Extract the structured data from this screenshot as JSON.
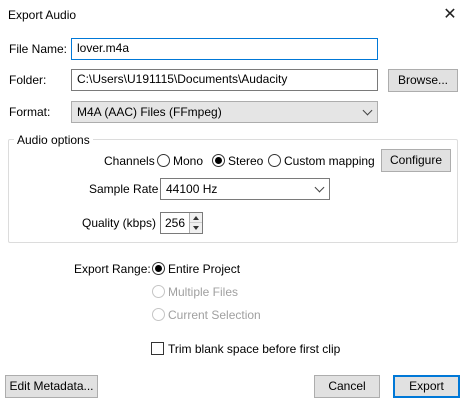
{
  "window": {
    "title": "Export Audio"
  },
  "file": {
    "file_name_label": "File Name:",
    "file_name_value": "lover.m4a",
    "folder_label": "Folder:",
    "folder_value": "C:\\Users\\U191115\\Documents\\Audacity",
    "browse_label": "Browse...",
    "format_label": "Format:",
    "format_value": "M4A (AAC) Files (FFmpeg)"
  },
  "audio_options": {
    "title": "Audio options",
    "channels_label": "Channels",
    "channel_options": [
      {
        "label": "Mono",
        "selected": false
      },
      {
        "label": "Stereo",
        "selected": true
      },
      {
        "label": "Custom mapping",
        "selected": false
      }
    ],
    "configure_label": "Configure",
    "sample_rate_label": "Sample Rate",
    "sample_rate_value": "44100 Hz",
    "quality_label": "Quality (kbps)",
    "quality_value": "256"
  },
  "export_range": {
    "label": "Export Range:",
    "options": [
      {
        "label": "Entire Project",
        "selected": true,
        "enabled": true
      },
      {
        "label": "Multiple Files",
        "selected": false,
        "enabled": false
      },
      {
        "label": "Current Selection",
        "selected": false,
        "enabled": false
      }
    ],
    "trim_label": "Trim blank space before first clip",
    "trim_checked": false
  },
  "footer": {
    "edit_metadata_label": "Edit Metadata...",
    "cancel_label": "Cancel",
    "export_label": "Export"
  },
  "colors": {
    "focus": "#0078d7",
    "button_bg": "#e1e1e1",
    "disabled": "#a0a0a0"
  }
}
